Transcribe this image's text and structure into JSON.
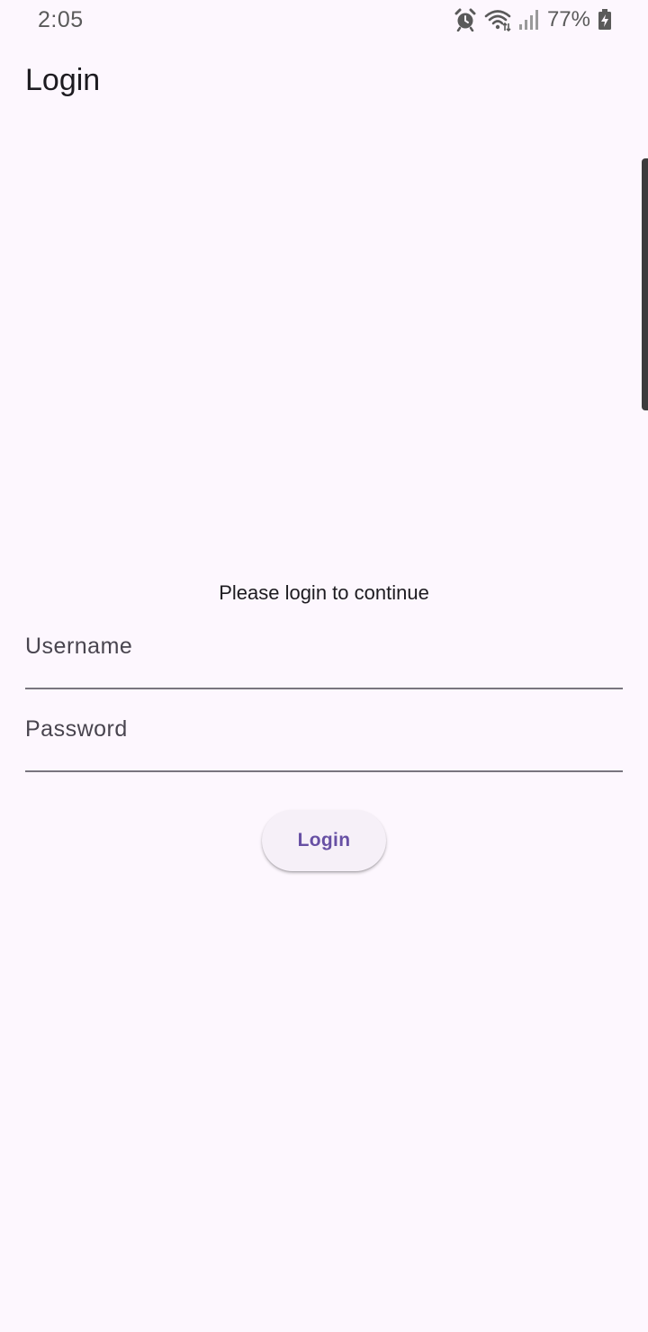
{
  "status_bar": {
    "time": "2:05",
    "battery_percent": "77%",
    "icons": [
      "alarm-icon",
      "wifi-icon",
      "signal-icon",
      "battery-charging-icon"
    ]
  },
  "app_bar": {
    "title": "Login"
  },
  "form": {
    "prompt": "Please login to continue",
    "username": {
      "placeholder": "Username",
      "value": ""
    },
    "password": {
      "placeholder": "Password",
      "value": ""
    },
    "submit_label": "Login"
  },
  "colors": {
    "background": "#fdf7fe",
    "primary": "#6750a4",
    "button_surface": "#f6f0f8",
    "underline": "#79757f",
    "text": "#1d1b20"
  }
}
